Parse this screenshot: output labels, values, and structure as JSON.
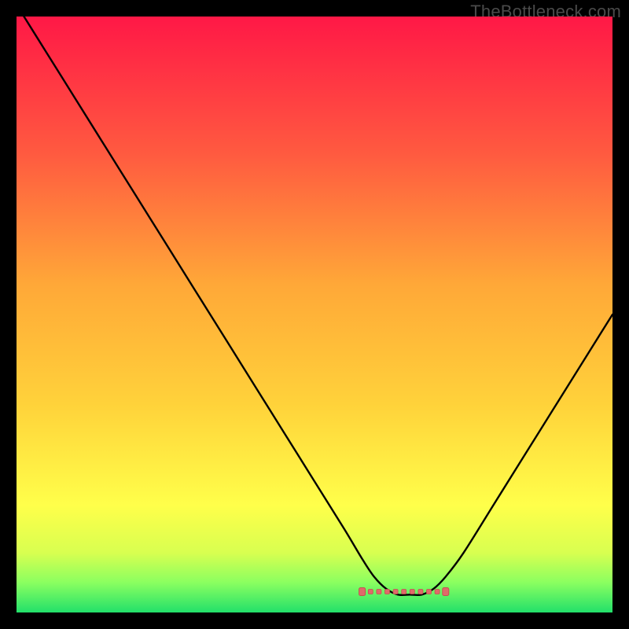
{
  "watermark": "TheBottleneck.com",
  "colors": {
    "gradient_top": "#ff1846",
    "gradient_mid_high": "#ff6a3f",
    "gradient_mid": "#ffd23a",
    "gradient_low_yellow": "#ffff4a",
    "gradient_lower": "#d8ff50",
    "gradient_near_bottom": "#8aff60",
    "gradient_bottom": "#22e06a",
    "curve": "#000000",
    "marker_fill": "#e06a6a",
    "marker_stroke": "#c55050",
    "background": "#000000"
  },
  "chart_data": {
    "type": "line",
    "title": "",
    "xlabel": "",
    "ylabel": "",
    "xlim": [
      0,
      100
    ],
    "ylim": [
      0,
      100
    ],
    "series": [
      {
        "name": "bottleneck-curve",
        "x": [
          0,
          5,
          10,
          15,
          20,
          25,
          30,
          35,
          40,
          45,
          50,
          55,
          58,
          60,
          62,
          64,
          66,
          68,
          70,
          72,
          75,
          80,
          85,
          90,
          95,
          100
        ],
        "y": [
          102,
          94,
          86,
          78,
          70,
          62,
          54,
          46,
          38,
          30,
          22,
          14,
          9,
          6,
          4,
          3,
          3,
          3,
          4,
          6,
          10,
          18,
          26,
          34,
          42,
          50
        ]
      }
    ],
    "annotations": {
      "flat_region": {
        "x_start": 58,
        "x_end": 72,
        "y": 3.5
      }
    }
  }
}
